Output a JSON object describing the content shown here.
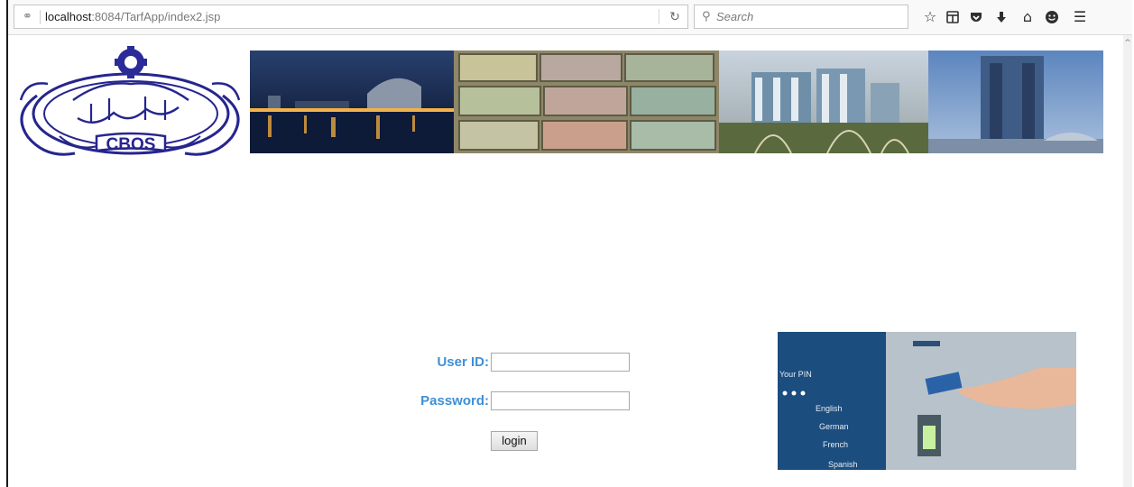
{
  "browser": {
    "url_host": "localhost",
    "url_rest": ":8084/TarfApp/index2.jsp",
    "search_placeholder": "Search"
  },
  "logo": {
    "text": "CBOS"
  },
  "atm": {
    "screen_lines": [
      "Your PIN",
      "English",
      "German",
      "French",
      "Spanish"
    ]
  },
  "login": {
    "user_label": "User ID:",
    "password_label": "Password:",
    "button_label": "login",
    "user_value": "",
    "password_value": ""
  }
}
